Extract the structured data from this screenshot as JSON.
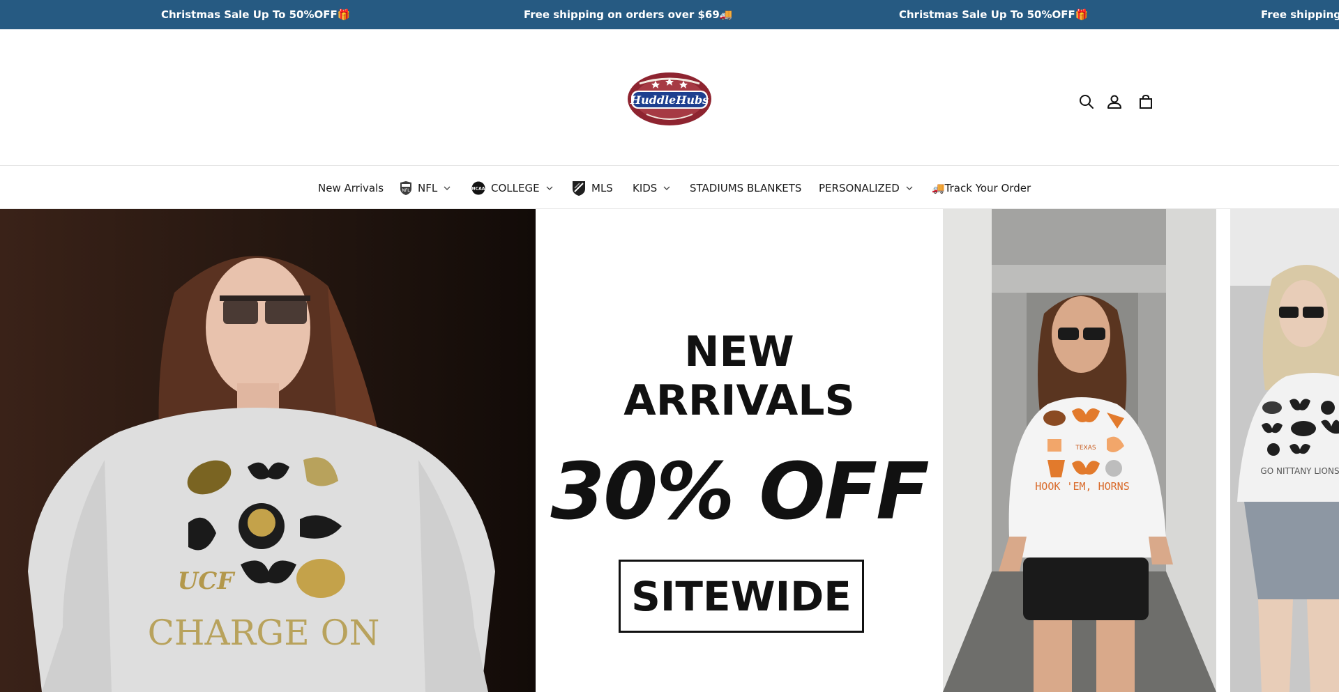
{
  "announcement": {
    "items": [
      "Christmas Sale Up To 50%OFF🎁",
      "Free shipping on orders over $69🚚",
      "Christmas Sale Up To 50%OFF🎁",
      "Free shipping o"
    ]
  },
  "brand": {
    "logo_text": "HuddleHubs",
    "colors": {
      "announcement_bg": "#265a82",
      "logo_red": "#8e2430",
      "logo_blue": "#1d3f8f"
    }
  },
  "header": {
    "icons": [
      "search-icon",
      "account-icon",
      "cart-icon"
    ]
  },
  "nav": {
    "items": [
      {
        "label": "New Arrivals"
      },
      {
        "label": "NFL",
        "icon": "nfl-shield-icon",
        "dropdown": true
      },
      {
        "label": "COLLEGE",
        "icon": "ncaa-icon",
        "dropdown": true
      },
      {
        "label": "MLS",
        "icon": "mls-shield-icon"
      },
      {
        "label": "KIDS",
        "dropdown": true
      },
      {
        "label": "STADIUMS BLANKETS"
      },
      {
        "label": "PERSONALIZED",
        "dropdown": true
      },
      {
        "label": "🚚Track Your Order"
      }
    ]
  },
  "hero": {
    "promo": {
      "line1": "NEW",
      "line2": "ARRIVALS",
      "discount": "30% OFF",
      "scope": "SITEWIDE"
    },
    "shirt_texts": {
      "left": "CHARGE ON",
      "left_badge": "UCF",
      "right": "HOOK 'EM, HORNS",
      "far_right": "GO NITTANY LIONS"
    }
  }
}
